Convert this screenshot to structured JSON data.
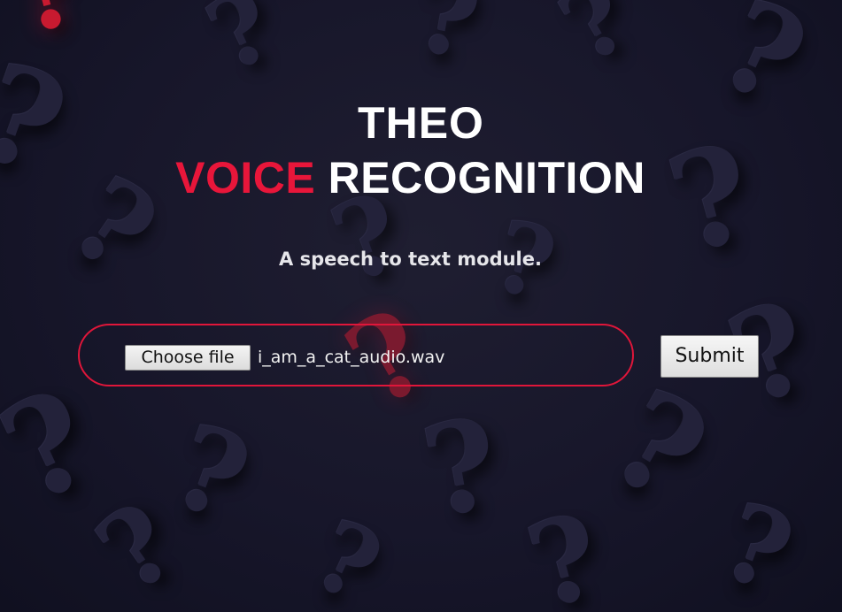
{
  "header": {
    "title_line1": "THEO",
    "title_accent": "VOICE",
    "title_rest": " RECOGNITION"
  },
  "subtitle": "A speech to text module.",
  "upload": {
    "choose_label": "Choose file",
    "file_name": "i_am_a_cat_audio.wav"
  },
  "submit_label": "Submit",
  "colors": {
    "background": "#171626",
    "accent": "#e8163a",
    "text": "#ffffff"
  },
  "background_glyph": "?"
}
